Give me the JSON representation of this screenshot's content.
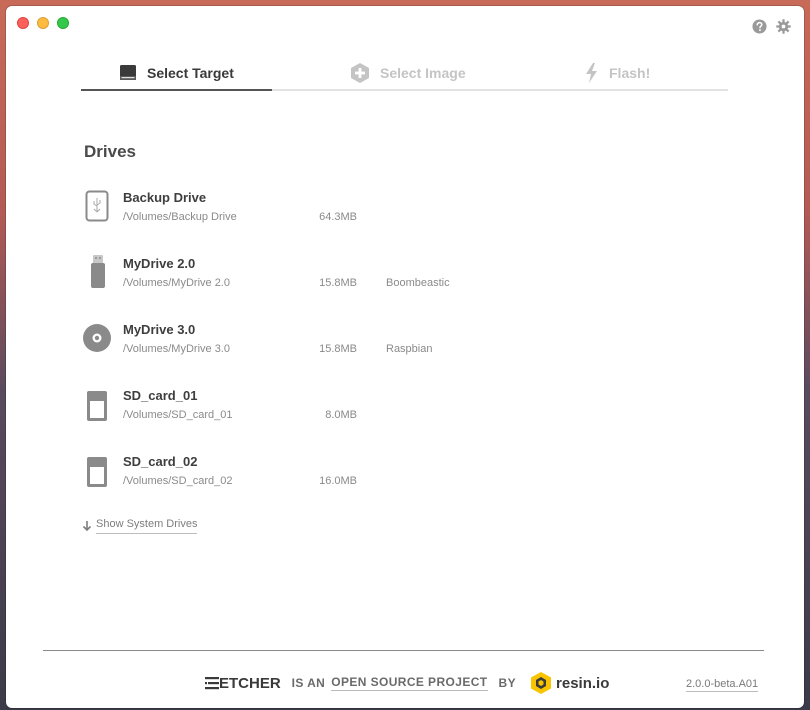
{
  "window": {
    "help_icon": "help-circle-icon",
    "settings_icon": "gear-icon"
  },
  "steps": [
    {
      "label": "Select Target",
      "icon": "drive-icon",
      "state": "active"
    },
    {
      "label": "Select Image",
      "icon": "plus-circle-icon",
      "state": "disabled"
    },
    {
      "label": "Flash!",
      "icon": "lightning-icon",
      "state": "disabled"
    }
  ],
  "drives_title": "Drives",
  "drives": [
    {
      "name": "Backup Drive",
      "path": "/Volumes/Backup Drive",
      "size": "64.3MB",
      "image": "",
      "icon": "usb-drive-icon"
    },
    {
      "name": "MyDrive 2.0",
      "path": "/Volumes/MyDrive 2.0",
      "size": "15.8MB",
      "image": "Boombeastic",
      "icon": "usb-stick-icon"
    },
    {
      "name": "MyDrive 3.0",
      "path": "/Volumes/MyDrive 3.0",
      "size": "15.8MB",
      "image": "Raspbian",
      "icon": "disc-icon"
    },
    {
      "name": "SD_card_01",
      "path": "/Volumes/SD_card_01",
      "size": "8.0MB",
      "image": "",
      "icon": "sd-card-icon"
    },
    {
      "name": "SD_card_02",
      "path": "/Volumes/SD_card_02",
      "size": "16.0MB",
      "image": "",
      "icon": "sd-card-icon"
    }
  ],
  "show_system_drives": "Show System Drives",
  "footer": {
    "etcher_logo": "ETCHER",
    "is_an": "IS AN",
    "open_source_project": "OPEN SOURCE PROJECT",
    "by": "BY",
    "resin_logo": "resin.io",
    "version": "2.0.0-beta.A01"
  },
  "colors": {
    "active_text": "#3a3a3a",
    "disabled_text": "#c4c4c4",
    "resin_yellow": "#f8c400"
  }
}
